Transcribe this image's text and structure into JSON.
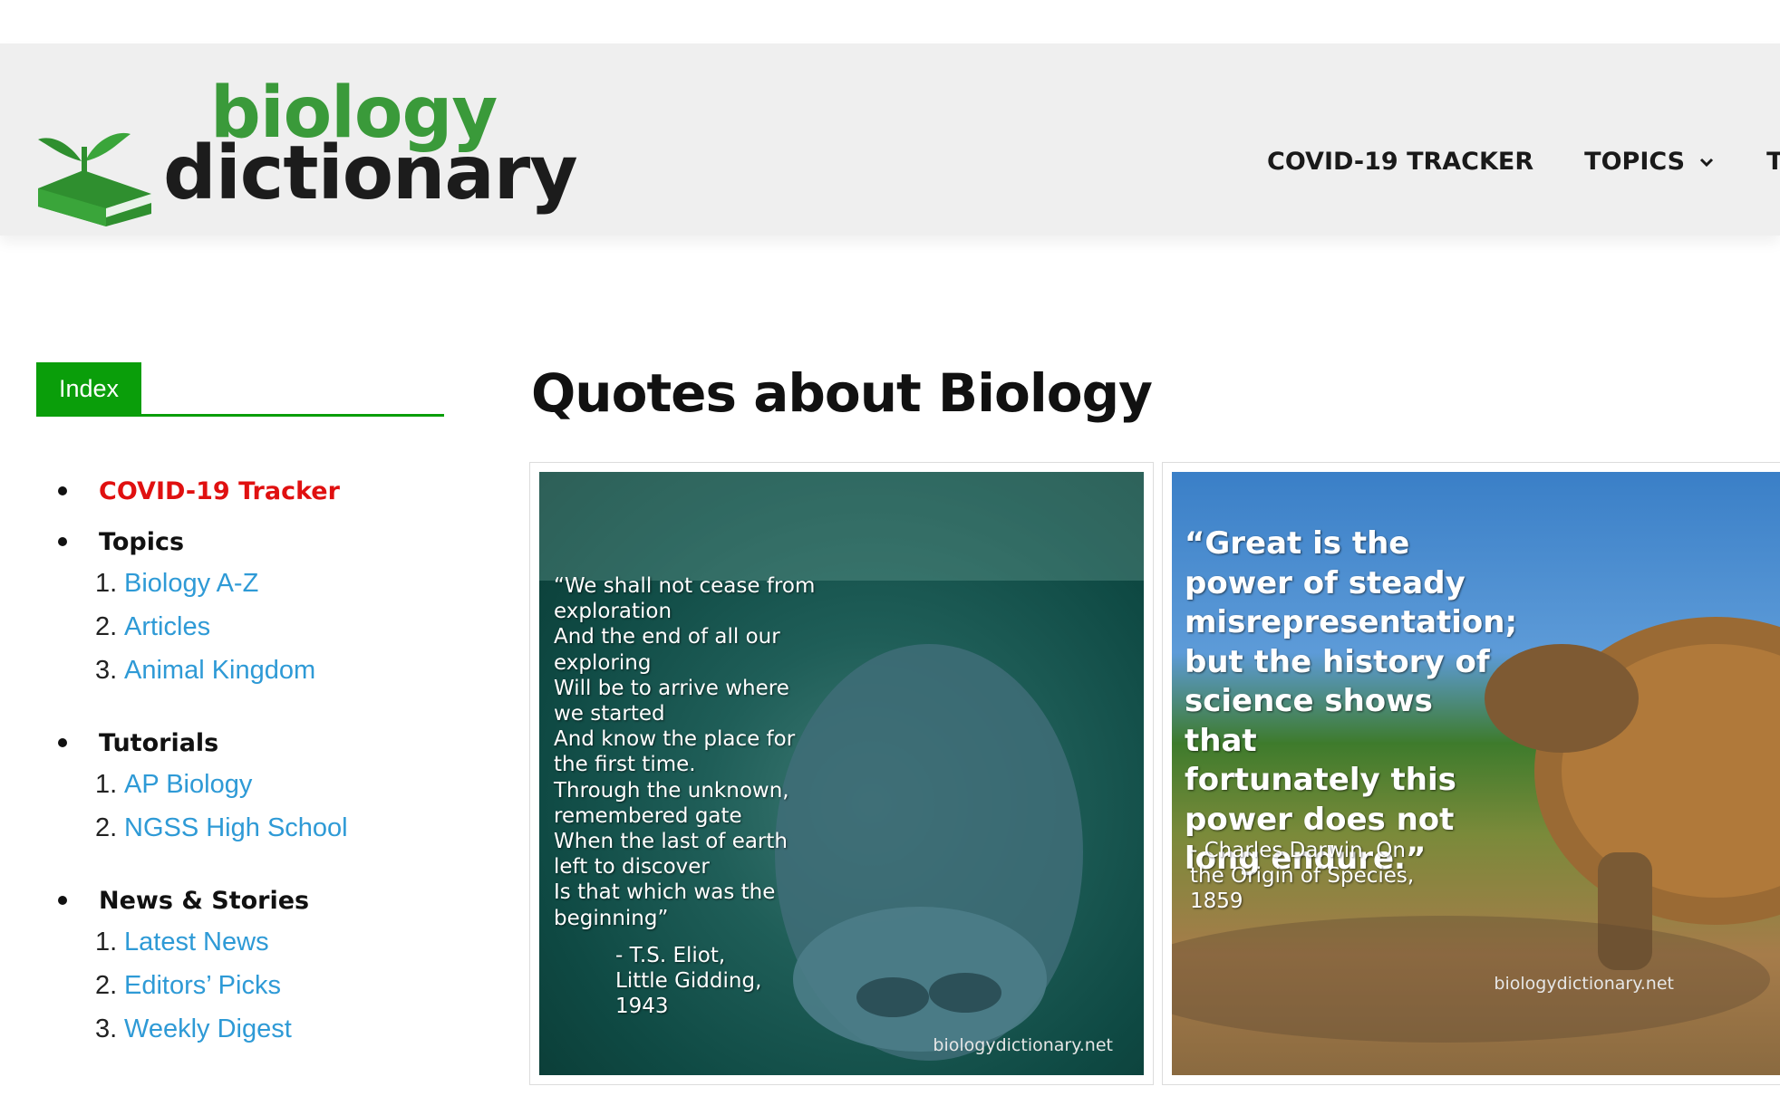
{
  "header": {
    "logo_top": "biology",
    "logo_bottom": "dictionary",
    "nav": [
      {
        "label": "COVID-19 TRACKER"
      },
      {
        "label": "TOPICS"
      },
      {
        "label": "TUTO"
      }
    ]
  },
  "sidebar": {
    "index_label": "Index",
    "groups": [
      {
        "title": "COVID-19 Tracker",
        "items": []
      },
      {
        "title": "Topics",
        "items": [
          {
            "num": "1.",
            "label": "Biology A-Z"
          },
          {
            "num": "2.",
            "label": "Articles"
          },
          {
            "num": "3.",
            "label": "Animal Kingdom"
          }
        ]
      },
      {
        "title": "Tutorials",
        "items": [
          {
            "num": "1.",
            "label": "AP Biology"
          },
          {
            "num": "2.",
            "label": "NGSS High School"
          }
        ]
      },
      {
        "title": "News & Stories",
        "items": [
          {
            "num": "1.",
            "label": "Latest News"
          },
          {
            "num": "2.",
            "label": "Editors’ Picks"
          },
          {
            "num": "3.",
            "label": "Weekly Digest"
          }
        ]
      }
    ]
  },
  "main": {
    "title": "Quotes about Biology",
    "cards": [
      {
        "quote": "“We shall not cease from\nexploration\nAnd the end of all our\nexploring\nWill be to arrive where\nwe started\nAnd know the place for\nthe first time.\nThrough the unknown,\nremembered gate\nWhen the last of earth\nleft to discover\nIs that which was the\nbeginning”",
        "attribution": "- T.S. Eliot,\nLittle Gidding,\n1943",
        "watermark": "biologydictionary.net"
      },
      {
        "quote": "“Great is the\npower of steady\nmisrepresentation;\nbut the history of\nscience shows that\nfortunately this\npower does not\nlong endure.”",
        "attribution": " - Charles Darwin, On\nthe Origin of Species,\n1859",
        "watermark": "biologydictionary.net"
      }
    ]
  },
  "colors": {
    "accent_green": "#0a9e0a",
    "link_blue": "#2e9ad6",
    "covid_red": "#e01010",
    "header_bg": "#efefef"
  }
}
